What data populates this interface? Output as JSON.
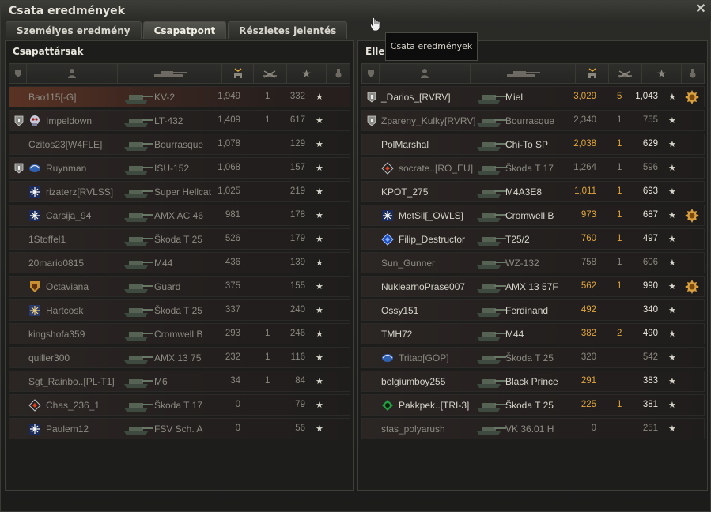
{
  "window": {
    "title": "Csata eredmények"
  },
  "tabs": [
    {
      "label": "Személyes eredmény",
      "active": false
    },
    {
      "label": "Csapatpont",
      "active": true
    },
    {
      "label": "Részletes jelentés",
      "active": false
    }
  ],
  "tooltip": {
    "text": "Csata eredmények"
  },
  "colors": {
    "damage": "#e1a63c",
    "text": "#d4d2c8",
    "dimmed": "#8c8a82",
    "highlight_row": "#5a3324"
  },
  "left_team": {
    "title": "Csapattársak",
    "rows": [
      {
        "player": "Bao115[-G]",
        "tank": "KV-2",
        "damage": "1,949",
        "kills": "1",
        "xp": "332",
        "rank": false,
        "clan": "",
        "first": true,
        "dead": true
      },
      {
        "player": "Impeldown",
        "tank": "LT-432",
        "damage": "1,409",
        "kills": "1",
        "xp": "617",
        "rank": true,
        "clan": "skull-clan-icon",
        "dead": true
      },
      {
        "player": "Czitos23[W4FLE]",
        "tank": "Bourrasque",
        "damage": "1,078",
        "kills": "",
        "xp": "129",
        "rank": false,
        "clan": "",
        "dead": true
      },
      {
        "player": "Ruynman",
        "tank": "ISU-152",
        "damage": "1,068",
        "kills": "",
        "xp": "157",
        "rank": true,
        "clan": "wing-clan-icon",
        "dead": true
      },
      {
        "player": "rizaterz[RVLSS]",
        "tank": "Super Hellcat",
        "damage": "1,025",
        "kills": "",
        "xp": "219",
        "rank": false,
        "clan": "snowflake-clan-icon",
        "dead": true
      },
      {
        "player": "Carsija_94",
        "tank": "AMX AC 46",
        "damage": "981",
        "kills": "",
        "xp": "178",
        "rank": false,
        "clan": "snowflake-clan-icon",
        "dead": true
      },
      {
        "player": "1Stoffel1",
        "tank": "Škoda T 25",
        "damage": "526",
        "kills": "",
        "xp": "179",
        "rank": false,
        "clan": "",
        "dead": true
      },
      {
        "player": "20mario0815",
        "tank": "M44",
        "damage": "436",
        "kills": "",
        "xp": "139",
        "rank": false,
        "clan": "",
        "dead": true
      },
      {
        "player": "Octaviana",
        "tank": "Guard",
        "damage": "375",
        "kills": "",
        "xp": "155",
        "rank": false,
        "clan": "shield-clan-icon",
        "dead": true
      },
      {
        "player": "Hartcosk",
        "tank": "Škoda T 25",
        "damage": "337",
        "kills": "",
        "xp": "240",
        "rank": false,
        "clan": "snowflake-gold-clan-icon",
        "dead": true
      },
      {
        "player": "kingshofa359",
        "tank": "Cromwell B",
        "damage": "293",
        "kills": "1",
        "xp": "246",
        "rank": false,
        "clan": "",
        "dead": true
      },
      {
        "player": "quiller300",
        "tank": "AMX 13 75",
        "damage": "232",
        "kills": "1",
        "xp": "116",
        "rank": false,
        "clan": "",
        "dead": true
      },
      {
        "player": "Sgt_Rainbo..[PL-T1]",
        "tank": "M6",
        "damage": "34",
        "kills": "1",
        "xp": "84",
        "rank": false,
        "clan": "",
        "dead": true
      },
      {
        "player": "Chas_236_1",
        "tank": "Škoda T 17",
        "damage": "0",
        "kills": "",
        "xp": "79",
        "rank": false,
        "clan": "diamond-clan-icon",
        "dead": true
      },
      {
        "player": "Paulem12",
        "tank": "FSV Sch. A",
        "damage": "0",
        "kills": "",
        "xp": "56",
        "rank": false,
        "clan": "snowflake-clan-icon",
        "dead": true
      }
    ]
  },
  "right_team": {
    "title": "Ellen",
    "rows": [
      {
        "player": "_Darios_[RVRV]",
        "tank": "Miel",
        "damage": "3,029",
        "kills": "5",
        "xp": "1,043",
        "rank": true,
        "clan": "",
        "dead": false,
        "medal": true
      },
      {
        "player": "Zpareny_Kulky[RVRV]",
        "tank": "Bourrasque",
        "damage": "2,340",
        "kills": "1",
        "xp": "755",
        "rank": true,
        "clan": "",
        "dead": true
      },
      {
        "player": "PolMarshal",
        "tank": "Chi-To SP",
        "damage": "2,038",
        "kills": "1",
        "xp": "629",
        "rank": false,
        "clan": "",
        "dead": false
      },
      {
        "player": "socrate..[RO_EU]",
        "tank": "Škoda T 17",
        "damage": "1,264",
        "kills": "1",
        "xp": "596",
        "rank": false,
        "clan": "diamond-clan-icon",
        "dead": true
      },
      {
        "player": "KPOT_275",
        "tank": "M4A3E8",
        "damage": "1,011",
        "kills": "1",
        "xp": "693",
        "rank": false,
        "clan": "",
        "dead": false
      },
      {
        "player": "MetSil[_OWLS]",
        "tank": "Cromwell B",
        "damage": "973",
        "kills": "1",
        "xp": "687",
        "rank": false,
        "clan": "snowflake-clan-icon",
        "dead": false,
        "medal": true
      },
      {
        "player": "Filip_Destructor",
        "tank": "T25/2",
        "damage": "760",
        "kills": "1",
        "xp": "497",
        "rank": false,
        "clan": "blue-diamond-clan-icon",
        "dead": false
      },
      {
        "player": "Sun_Gunner",
        "tank": "WZ-132",
        "damage": "758",
        "kills": "1",
        "xp": "606",
        "rank": false,
        "clan": "",
        "dead": true
      },
      {
        "player": "NuklearnoPrase007",
        "tank": "AMX 13 57F",
        "damage": "562",
        "kills": "1",
        "xp": "990",
        "rank": false,
        "clan": "",
        "dead": false,
        "medal": true
      },
      {
        "player": "Ossy151",
        "tank": "Ferdinand",
        "damage": "492",
        "kills": "",
        "xp": "340",
        "rank": false,
        "clan": "",
        "dead": false
      },
      {
        "player": "TMH72",
        "tank": "M44",
        "damage": "382",
        "kills": "2",
        "xp": "490",
        "rank": false,
        "clan": "",
        "dead": false
      },
      {
        "player": "Tritao[GOP]",
        "tank": "Škoda T 25",
        "damage": "320",
        "kills": "",
        "xp": "542",
        "rank": false,
        "clan": "wing-clan-icon",
        "dead": true
      },
      {
        "player": "belgiumboy255",
        "tank": "Black Prince",
        "damage": "291",
        "kills": "",
        "xp": "383",
        "rank": false,
        "clan": "",
        "dead": false
      },
      {
        "player": "Pakkpek..[TRI-3]",
        "tank": "Škoda T 25",
        "damage": "225",
        "kills": "1",
        "xp": "381",
        "rank": false,
        "clan": "green-clan-icon",
        "dead": false
      },
      {
        "player": "stas_polyarush",
        "tank": "VK 36.01 H",
        "damage": "0",
        "kills": "",
        "xp": "251",
        "rank": false,
        "clan": "",
        "dead": true
      }
    ]
  }
}
